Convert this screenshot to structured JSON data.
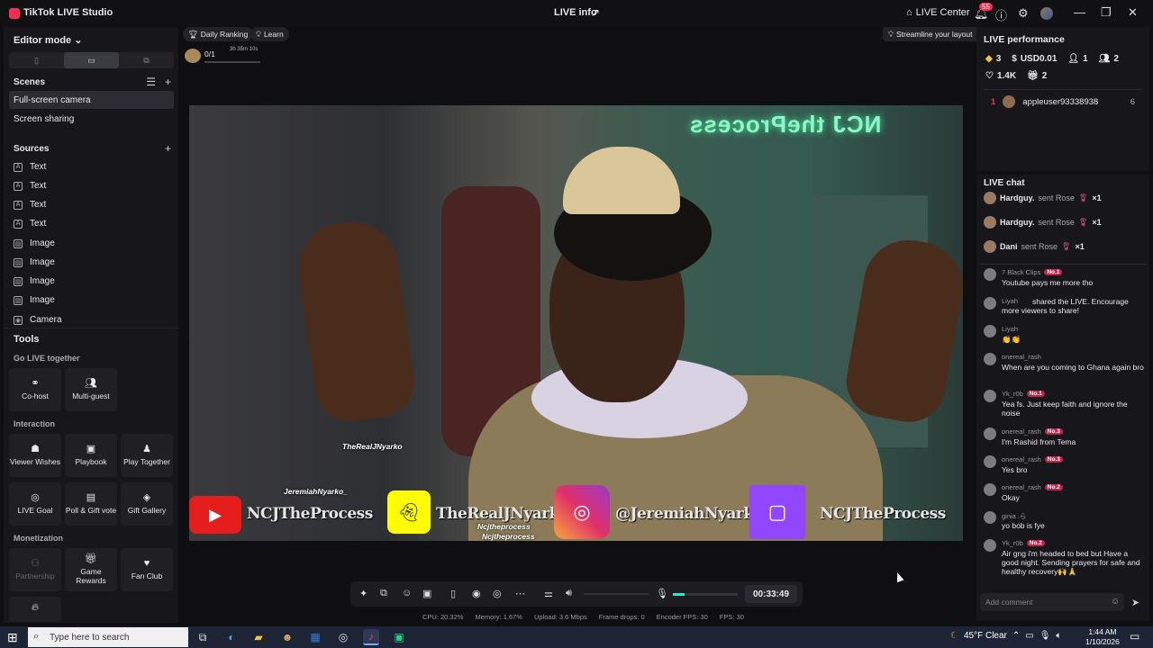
{
  "titlebar": {
    "app_title": "TikTok LIVE Studio",
    "center_title": "LIVE info",
    "live_center": "LIVE Center",
    "notification_count": "55"
  },
  "left": {
    "editor_mode": "Editor mode",
    "scenes_head": "Scenes",
    "scenes": [
      "Full-screen camera",
      "Screen sharing"
    ],
    "sources_head": "Sources",
    "sources": [
      {
        "icon": "text-icon",
        "label": "Text"
      },
      {
        "icon": "text-icon",
        "label": "Text"
      },
      {
        "icon": "text-icon",
        "label": "Text"
      },
      {
        "icon": "text-icon",
        "label": "Text"
      },
      {
        "icon": "image-icon",
        "label": "Image"
      },
      {
        "icon": "image-icon",
        "label": "Image"
      },
      {
        "icon": "image-icon",
        "label": "Image"
      },
      {
        "icon": "image-icon",
        "label": "Image"
      },
      {
        "icon": "camera-icon",
        "label": "Camera"
      }
    ]
  },
  "tools": {
    "head": "Tools",
    "groups": {
      "go_live": "Go LIVE together",
      "interaction": "Interaction",
      "monetization": "Monetization"
    },
    "cohost": "Co-host",
    "multiguest": "Multi-guest",
    "viewer_wishes": "Viewer Wishes",
    "playbook": "Playbook",
    "play_together": "Play Together",
    "live_goal": "LIVE Goal",
    "poll_gift": "Poll & Gift vote",
    "gift_gallery": "Gift Gallery",
    "partnership": "Partnership",
    "game_rewards": "Game Rewards",
    "fan_club": "Fan Club"
  },
  "stage": {
    "daily_ranking": "Daily Ranking",
    "learn": "Learn",
    "streamline": "Streamline your layout",
    "rank_count": "0/1",
    "rank_time": "3h 35m 10s",
    "neon_sign": "NCJ theProcess",
    "tag_top": "TheRealJNyarko",
    "tag_ig": "JeremiahNyarko_",
    "tag_sc1": "Ncjtheprocess",
    "tag_sc2": "Ncjtheprocess",
    "handle_yt": "NCJTheProcess",
    "handle_sc": "TheRealJNyarko",
    "handle_ig": "@JeremiahNyarko_",
    "handle_tw": "NCJTheProcess"
  },
  "controls": {
    "timer": "00:33:49",
    "mic_level": 0.18,
    "stats": [
      "CPU: 20.32%",
      "Memory: 1.67%",
      "Upload: 3.6 Mbps",
      "Frame drops: 0",
      "Encoder FPS: 30",
      "FPS: 30"
    ]
  },
  "performance": {
    "head": "LIVE performance",
    "diamonds": "3",
    "usd": "USD0.01",
    "new_followers": "1",
    "viewers": "2",
    "likes": "1.4K",
    "gifters": "2",
    "top_viewer": {
      "rank": "1",
      "name": "appleuser93338938",
      "count": "6"
    }
  },
  "chat": {
    "head": "LIVE chat",
    "gifts": [
      {
        "user": "Hardguy.",
        "text": "sent Rose",
        "count": "×1"
      },
      {
        "user": "Hardguy.",
        "text": "sent Rose",
        "count": "×1"
      },
      {
        "user": "Dani",
        "text": "sent Rose",
        "count": "×1"
      }
    ],
    "messages": [
      {
        "user": "7 Black Clips",
        "badge": "No.1",
        "text": "Youtube pays me more tho"
      },
      {
        "user": "Liyah",
        "badge": "",
        "text": "shared the LIVE. Encourage more viewers to share!"
      },
      {
        "user": "Liyah",
        "badge": "",
        "text": "👏👏"
      },
      {
        "user": "onereal_rash",
        "badge": "",
        "text": "When are you coming to Ghana again bro"
      },
      {
        "user": "Yk_r0b",
        "badge": "No.1",
        "text": "Yea fs. Just keep faith and ignore the noise"
      },
      {
        "user": "onereal_rash",
        "badge": "No.3",
        "text": "I'm Rashid from Tema"
      },
      {
        "user": "onereal_rash",
        "badge": "No.3",
        "text": "Yes bro"
      },
      {
        "user": "onereal_rash",
        "badge": "No.2",
        "text": "Okay"
      },
      {
        "user": "ginia .ら",
        "badge": "",
        "text": "yo bob is fye"
      },
      {
        "user": "Yk_r0b",
        "badge": "No.2",
        "text": "Air gng i'm headed to bed but Have a good night. Sending prayers for safe and healthy recovery🙌🙏"
      }
    ],
    "placeholder": "Add comment"
  },
  "taskbar": {
    "search_placeholder": "Type here to search",
    "weather": "45°F Clear",
    "time": "1:44 AM",
    "date": "1/10/2026"
  }
}
